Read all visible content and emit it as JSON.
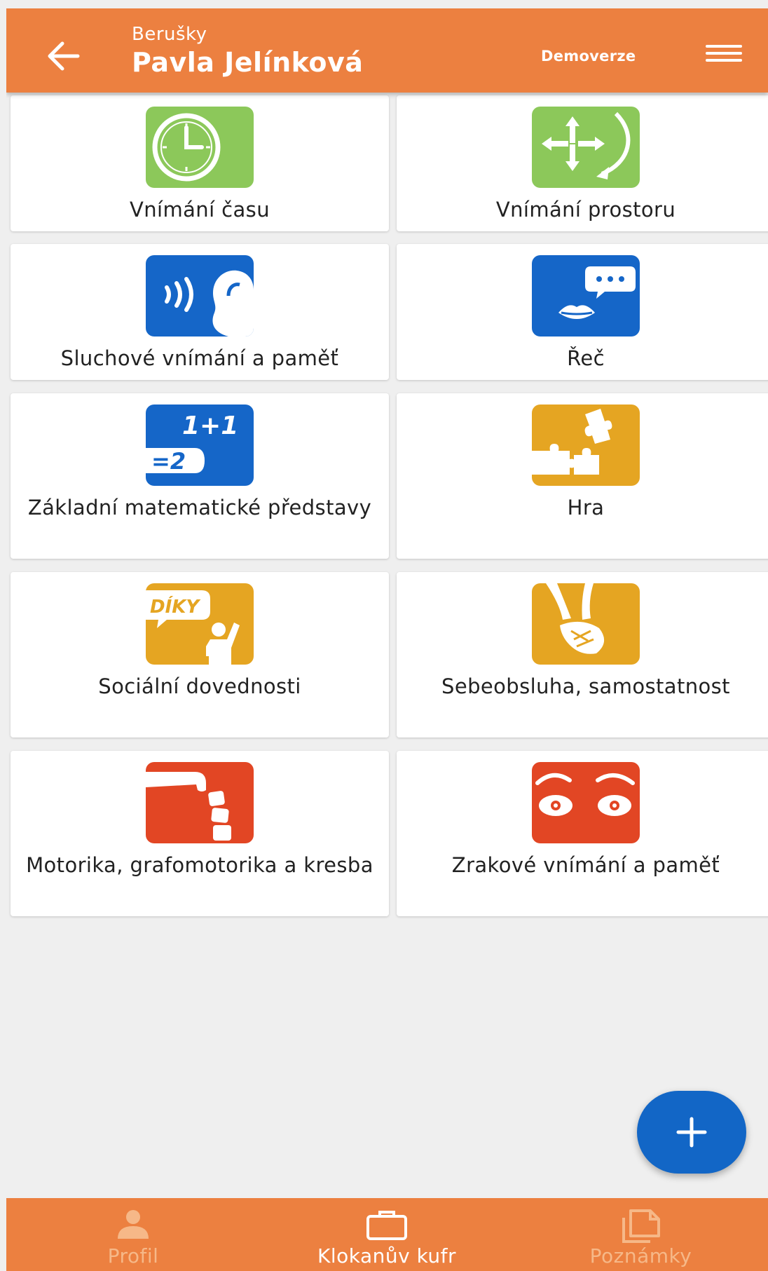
{
  "header": {
    "subtitle": "Berušky",
    "title": "Pavla Jelínková",
    "demo_label": "Demoverze"
  },
  "categories": [
    {
      "label": "Vnímání času",
      "icon": "clock-icon",
      "color": "#8cc85a"
    },
    {
      "label": "Vnímání prostoru",
      "icon": "space-arrows-icon",
      "color": "#8cc85a"
    },
    {
      "label": "Sluchové vnímání a paměť",
      "icon": "ear-icon",
      "color": "#1566c8"
    },
    {
      "label": "Řeč",
      "icon": "speech-lips-icon",
      "color": "#1566c8"
    },
    {
      "label": "Základní matematické představy",
      "icon": "math-icon",
      "color": "#1566c8",
      "tile_text_top": "1+1",
      "tile_text_bottom": "=2"
    },
    {
      "label": "Hra",
      "icon": "puzzle-icon",
      "color": "#e5a522"
    },
    {
      "label": "Sociální dovednosti",
      "icon": "social-thanks-icon",
      "color": "#e5a522",
      "tile_text": "DÍKY"
    },
    {
      "label": "Sebeobsluha, samostatnost",
      "icon": "shoe-lacing-icon",
      "color": "#e5a522"
    },
    {
      "label": "Motorika, grafomotorika a kresba",
      "icon": "hand-blocks-icon",
      "color": "#e24624"
    },
    {
      "label": "Zrakové vnímání a paměť",
      "icon": "eyes-icon",
      "color": "#e24624"
    }
  ],
  "fab": {
    "icon": "plus-icon"
  },
  "bottom_nav": [
    {
      "label": "Profil",
      "icon": "person-icon",
      "active": false
    },
    {
      "label": "Klokanův kufr",
      "icon": "briefcase-icon",
      "active": true
    },
    {
      "label": "Poznámky",
      "icon": "notes-icon",
      "active": false
    }
  ]
}
